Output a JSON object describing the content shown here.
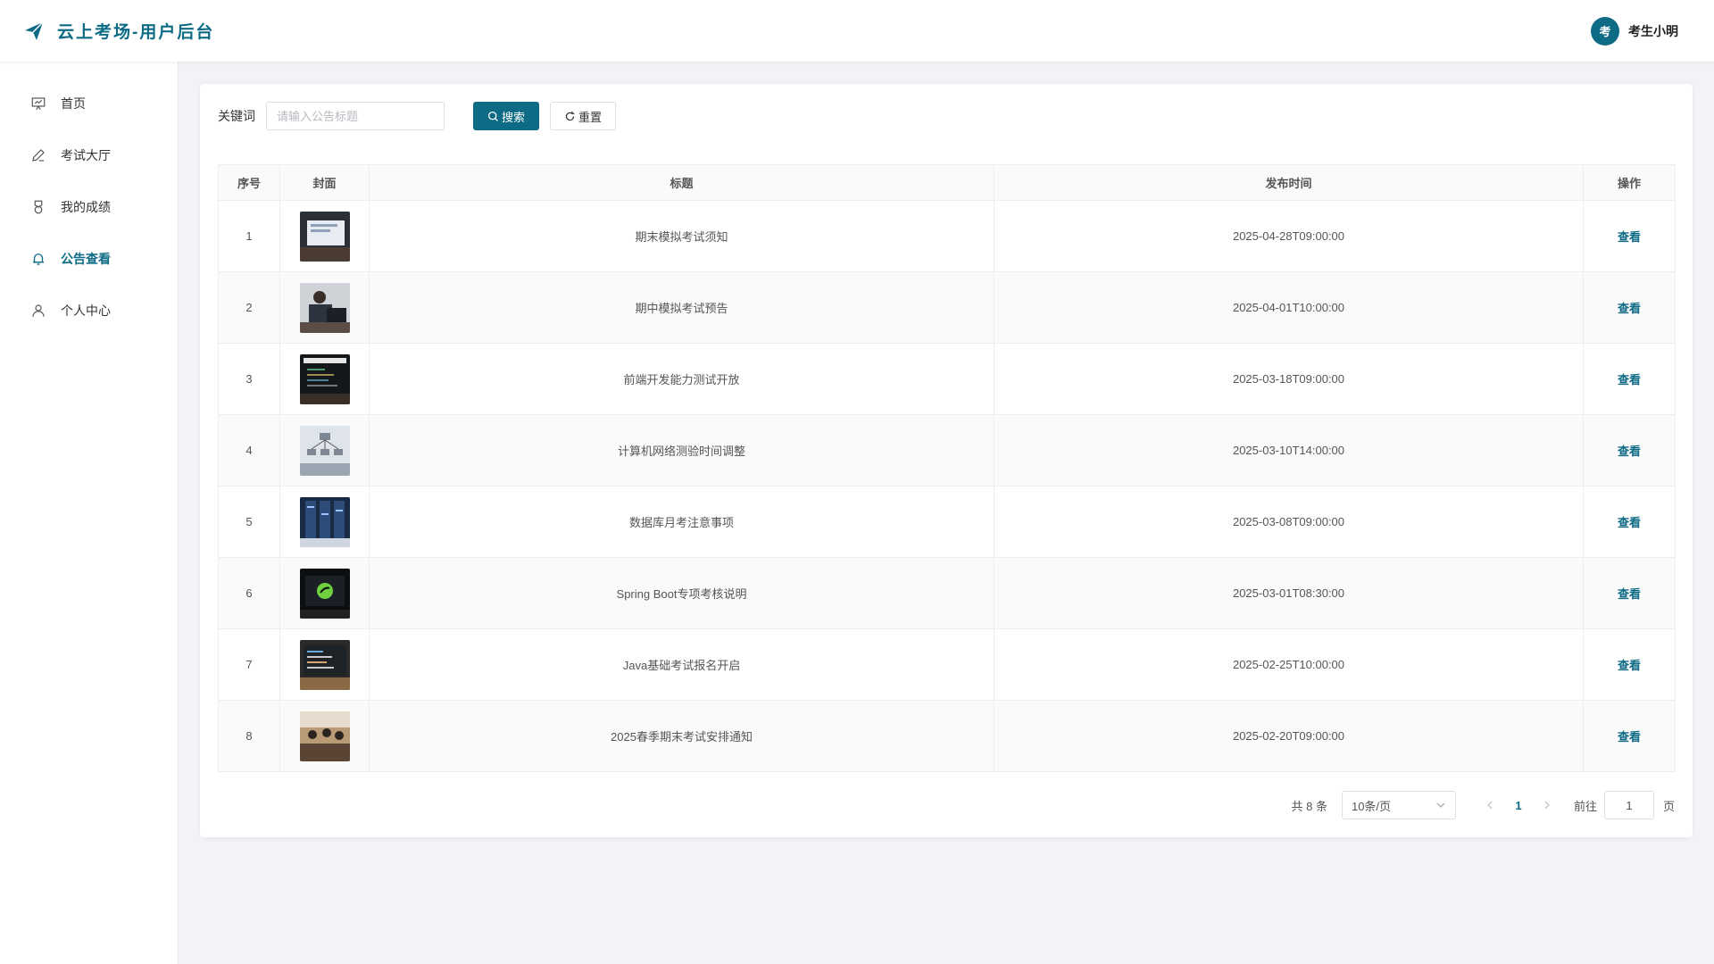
{
  "app": {
    "title": "云上考场-用户后台",
    "logo_icon": "paper-plane-icon",
    "accent_color": "#0e6b86"
  },
  "user": {
    "avatar_text": "考",
    "name": "考生小明"
  },
  "sidebar": {
    "items": [
      {
        "label": "首页",
        "icon": "presentation-icon",
        "active": false
      },
      {
        "label": "考试大厅",
        "icon": "pen-icon",
        "active": false
      },
      {
        "label": "我的成绩",
        "icon": "medal-icon",
        "active": false
      },
      {
        "label": "公告查看",
        "icon": "bell-icon",
        "active": true
      },
      {
        "label": "个人中心",
        "icon": "user-icon",
        "active": false
      }
    ]
  },
  "search": {
    "label": "关键词",
    "value": "",
    "placeholder": "请输入公告标题",
    "search_label": "搜索",
    "reset_label": "重置"
  },
  "table": {
    "headers": [
      "序号",
      "封面",
      "标题",
      "发布时间",
      "操作"
    ],
    "action_label": "查看",
    "rows": [
      {
        "index": "1",
        "title": "期末模拟考试须知",
        "time": "2025-04-28T09:00:00",
        "cover": "laptop-photo"
      },
      {
        "index": "2",
        "title": "期中模拟考试预告",
        "time": "2025-04-01T10:00:00",
        "cover": "students-photo"
      },
      {
        "index": "3",
        "title": "前端开发能力测试开放",
        "time": "2025-03-18T09:00:00",
        "cover": "code-screen-photo"
      },
      {
        "index": "4",
        "title": "计算机网络测验时间调整",
        "time": "2025-03-10T14:00:00",
        "cover": "network-diagram-photo"
      },
      {
        "index": "5",
        "title": "数据库月考注意事项",
        "time": "2025-03-08T09:00:00",
        "cover": "server-rack-photo"
      },
      {
        "index": "6",
        "title": "Spring Boot专项考核说明",
        "time": "2025-03-01T08:30:00",
        "cover": "spring-logo-photo"
      },
      {
        "index": "7",
        "title": "Java基础考试报名开启",
        "time": "2025-02-25T10:00:00",
        "cover": "monitor-code-photo"
      },
      {
        "index": "8",
        "title": "2025春季期末考试安排通知",
        "time": "2025-02-20T09:00:00",
        "cover": "exam-hall-photo"
      }
    ]
  },
  "pagination": {
    "total_text": "共 8 条",
    "page_size_text": "10条/页",
    "current_page": "1",
    "goto_label": "前往",
    "goto_value": "1",
    "page_unit": "页"
  }
}
